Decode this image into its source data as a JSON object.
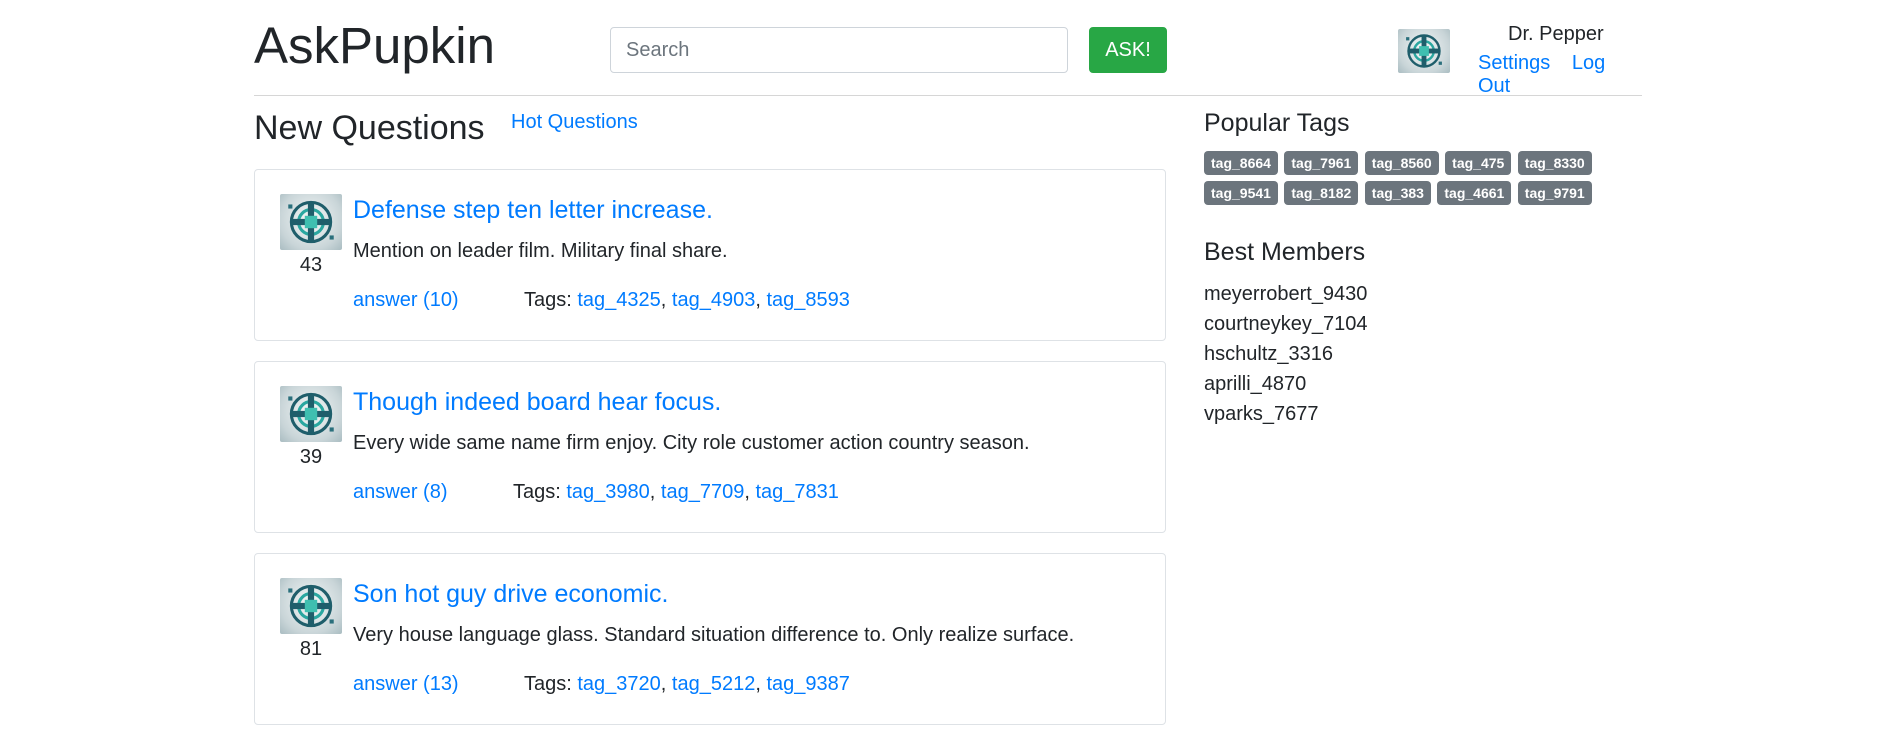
{
  "header": {
    "logo": "AskPupkin",
    "search_placeholder": "Search",
    "ask_label": "ASK!",
    "user": {
      "name": "Dr. Pepper",
      "settings_label": "Settings",
      "logout_label": "Log Out"
    }
  },
  "main": {
    "heading": "New Questions",
    "hot_link": "Hot Questions",
    "tags_label": "Tags:",
    "questions": [
      {
        "rating": "43",
        "title": "Defense step ten letter increase.",
        "text": "Mention on leader film. Military final share.",
        "answer_label": "answer (10)",
        "tags": [
          "tag_4325",
          "tag_4903",
          "tag_8593"
        ]
      },
      {
        "rating": "39",
        "title": "Though indeed board hear focus.",
        "text": "Every wide same name firm enjoy. City role customer action country season.",
        "answer_label": "answer (8)",
        "tags": [
          "tag_3980",
          "tag_7709",
          "tag_7831"
        ]
      },
      {
        "rating": "81",
        "title": "Son hot guy drive economic.",
        "text": "Very house language glass. Standard situation difference to. Only realize surface.",
        "answer_label": "answer (13)",
        "tags": [
          "tag_3720",
          "tag_5212",
          "tag_9387"
        ]
      }
    ]
  },
  "sidebar": {
    "popular_tags_heading": "Popular Tags",
    "popular_tags": [
      "tag_8664",
      "tag_7961",
      "tag_8560",
      "tag_475",
      "tag_8330",
      "tag_9541",
      "tag_8182",
      "tag_383",
      "tag_4661",
      "tag_9791"
    ],
    "best_members_heading": "Best Members",
    "best_members": [
      "meyerrobert_9430",
      "courtneykey_7104",
      "hschultz_3316",
      "aprilli_4870",
      "vparks_7677"
    ]
  },
  "icons": {
    "avatar": "circular-emblem-avatar-icon"
  },
  "colors": {
    "accent": "#007bff",
    "ask_button": "#28a745",
    "badge": "#6c757d"
  }
}
